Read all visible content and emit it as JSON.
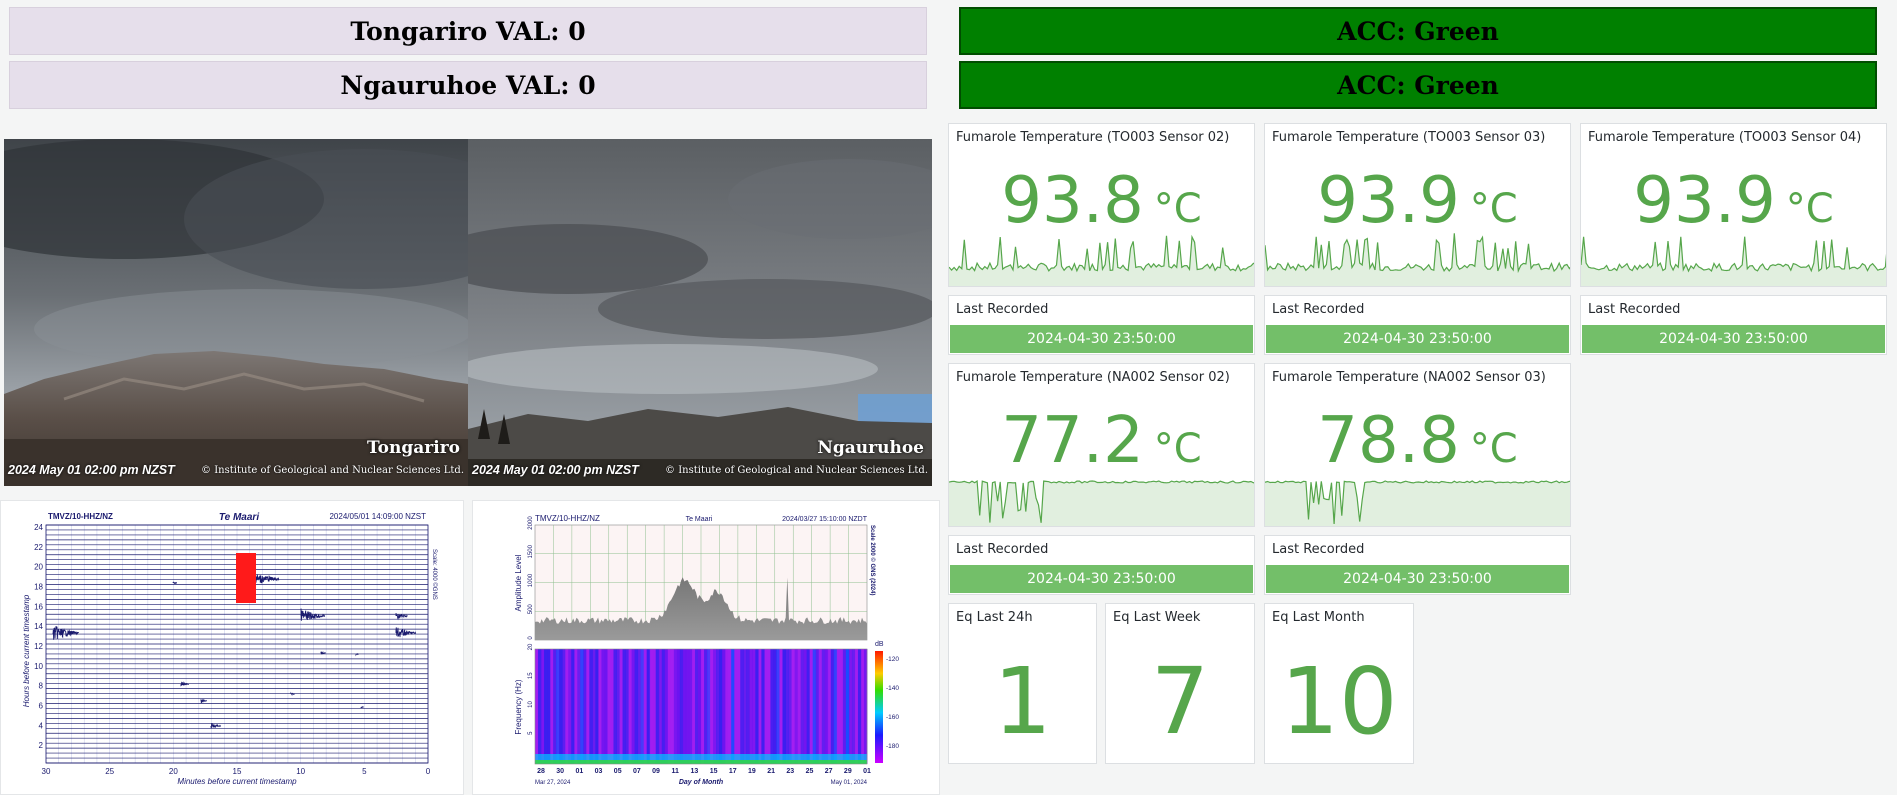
{
  "alerts": {
    "tongariro_val": "Tongariro VAL: 0",
    "ngauruhoe_val": "Ngauruhoe VAL: 0",
    "acc_1": "ACC: Green",
    "acc_2": "ACC: Green"
  },
  "webcams": [
    {
      "name": "Tongariro",
      "timestamp": "2024 May 01 02:00 pm NZST",
      "copyright": "© Institute of Geological and Nuclear Sciences Ltd."
    },
    {
      "name": "Ngauruhoe",
      "timestamp": "2024 May 01 02:00 pm NZST",
      "copyright": "© Institute of Geological and Nuclear Sciences Ltd."
    }
  ],
  "fumaroles": [
    {
      "title": "Fumarole Temperature (TO003 Sensor 02)",
      "value": "93.8",
      "unit": "°C"
    },
    {
      "title": "Fumarole Temperature (TO003 Sensor 03)",
      "value": "93.9",
      "unit": "°C"
    },
    {
      "title": "Fumarole Temperature (TO003 Sensor 04)",
      "value": "93.9",
      "unit": "°C"
    },
    {
      "title": "Fumarole Temperature (NA002 Sensor 02)",
      "value": "77.2",
      "unit": "°C"
    },
    {
      "title": "Fumarole Temperature (NA002 Sensor 03)",
      "value": "78.8",
      "unit": "°C"
    }
  ],
  "last_recorded": [
    {
      "title": "Last Recorded",
      "value": "2024-04-30 23:50:00"
    },
    {
      "title": "Last Recorded",
      "value": "2024-04-30 23:50:00"
    },
    {
      "title": "Last Recorded",
      "value": "2024-04-30 23:50:00"
    },
    {
      "title": "Last Recorded",
      "value": "2024-04-30 23:50:00"
    },
    {
      "title": "Last Recorded",
      "value": "2024-04-30 23:50:00"
    }
  ],
  "earthquakes": [
    {
      "title": "Eq Last 24h",
      "value": "1"
    },
    {
      "title": "Eq Last Week",
      "value": "7"
    },
    {
      "title": "Eq Last Month",
      "value": "10"
    }
  ],
  "drum": {
    "station": "TMVZ/10-HHZ/NZ",
    "site": "Te Maari",
    "timestamp": "2024/05/01 14:09:00 NZST",
    "ylabel": "Hours before current timestamp",
    "xlabel": "Minutes before current timestamp",
    "scale": "Scale: 4000 ©GNS",
    "yticks": [
      "24",
      "22",
      "20",
      "18",
      "16",
      "14",
      "12",
      "10",
      "8",
      "6",
      "4",
      "2"
    ],
    "xticks": [
      "30",
      "25",
      "20",
      "15",
      "10",
      "5",
      "0"
    ]
  },
  "rsam": {
    "station": "TMVZ/10-HHZ/NZ",
    "site": "Te Maari",
    "timestamp": "2024/03/27 15:10:00 NZDT",
    "amp_label": "Amplitude Level",
    "freq_label": "Frequency (Hz)",
    "scale": "Scale 2000 © GNS (2024)",
    "amp_ticks": [
      "2000",
      "1500",
      "1000",
      "500",
      "0"
    ],
    "freq_ticks": [
      "20",
      "15",
      "10",
      "5"
    ],
    "db_unit": "dB",
    "db_ticks": [
      "-120",
      "-140",
      "-160",
      "-180"
    ],
    "day_ticks": [
      "28",
      "30",
      "01",
      "03",
      "05",
      "07",
      "09",
      "11",
      "13",
      "15",
      "17",
      "19",
      "21",
      "23",
      "25",
      "27",
      "29",
      "01"
    ],
    "start_date": "Mar 27, 2024",
    "end_date": "May 01, 2024",
    "xlabel": "Day of Month"
  },
  "colors": {
    "alert_val_bg": "#e6dfeb",
    "acc_green": "#008000",
    "stat_green": "#56a64b",
    "bar_green": "#73bf69"
  }
}
